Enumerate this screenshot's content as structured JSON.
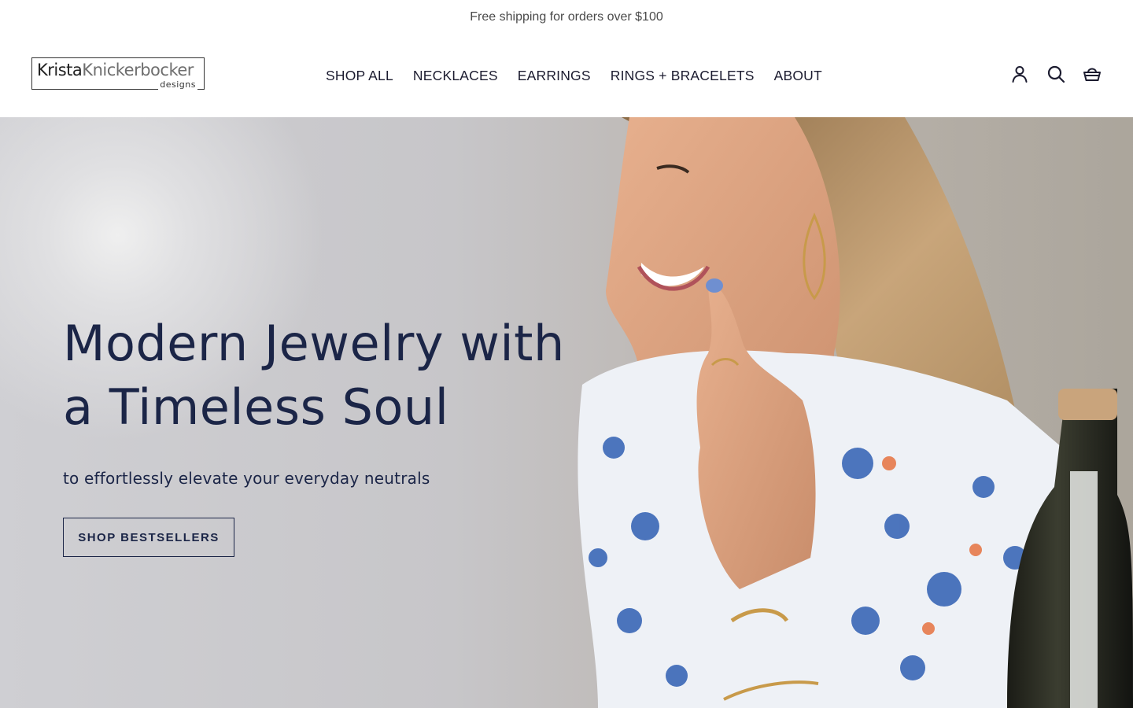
{
  "announcement": {
    "text": "Free shipping for orders over $100"
  },
  "header": {
    "logo": {
      "name_bold": "Krista",
      "name_light": "Knickerbocker",
      "sub": "designs"
    },
    "nav": [
      {
        "label": "SHOP ALL"
      },
      {
        "label": "NECKLACES"
      },
      {
        "label": "EARRINGS"
      },
      {
        "label": "RINGS + BRACELETS"
      },
      {
        "label": "ABOUT"
      }
    ],
    "icons": [
      "account-icon",
      "search-icon",
      "cart-icon"
    ]
  },
  "hero": {
    "title_line1": "Modern Jewelry with",
    "title_line2": "a Timeless Soul",
    "subtitle": "to effortlessly elevate your everyday neutrals",
    "cta_label": "SHOP BESTSELLERS"
  },
  "colors": {
    "heading": "#1b2547",
    "announcement_text": "#4a4a4a",
    "nav_text": "#1b1b2f"
  }
}
